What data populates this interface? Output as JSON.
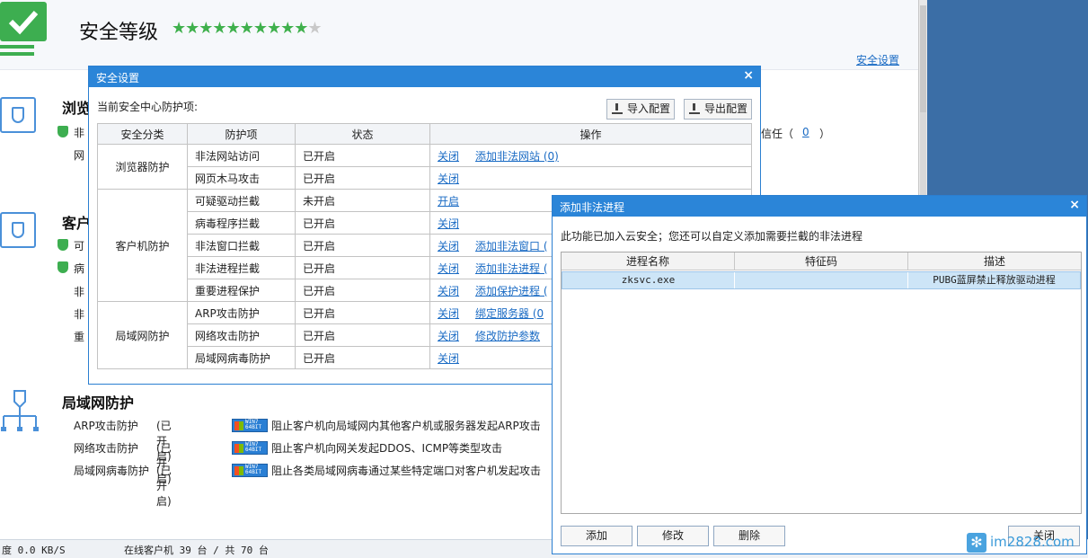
{
  "header": {
    "title": "安全等级",
    "stars_on": "★★★★★★★★★★",
    "stars_off": "★",
    "settings_link": "安全设置"
  },
  "sections": {
    "browser": {
      "title": "浏览"
    },
    "browser_rows": [
      "非",
      "网"
    ],
    "browser_right_text": "信任（",
    "browser_right_count": "0",
    "browser_right_close": "）",
    "client": {
      "title": "客户"
    },
    "client_rows": [
      "可",
      "病",
      "非",
      "非",
      "重"
    ],
    "lan": {
      "title": "局域网防护",
      "rows": [
        {
          "name": "ARP攻击防护",
          "status": "(已开启)",
          "badge": "WIN7 64BIT",
          "desc": "阻止客户机向局域网内其他客户机或服务器发起ARP攻击"
        },
        {
          "name": "网络攻击防护",
          "status": "(已开启)",
          "badge": "WIN7 64BIT",
          "desc": "阻止客户机向网关发起DDOS、ICMP等类型攻击"
        },
        {
          "name": "局域网病毒防护",
          "status": "(已开启)",
          "badge": "WIN7 64BIT",
          "desc": "阻止各类局域网病毒通过某些特定端口对客户机发起攻击"
        }
      ]
    }
  },
  "statusbar": {
    "speed": "度 0.0 KB/S",
    "online": "在线客户机 39 台 / 共 70 台"
  },
  "security_dialog": {
    "title": "安全设置",
    "close": "×",
    "subtitle": "当前安全中心防护项:",
    "import_btn": "导入配置",
    "export_btn": "导出配置",
    "columns": [
      "安全分类",
      "防护项",
      "状态",
      "操作"
    ],
    "groups": [
      {
        "category": "浏览器防护",
        "rows": [
          {
            "item": "非法网站访问",
            "status": "已开启",
            "action": "关闭",
            "extra": "添加非法网站 (0)"
          },
          {
            "item": "网页木马攻击",
            "status": "已开启",
            "action": "关闭",
            "extra": ""
          }
        ]
      },
      {
        "category": "客户机防护",
        "rows": [
          {
            "item": "可疑驱动拦截",
            "status": "未开启",
            "action": "开启",
            "extra": ""
          },
          {
            "item": "病毒程序拦截",
            "status": "已开启",
            "action": "关闭",
            "extra": ""
          },
          {
            "item": "非法窗口拦截",
            "status": "已开启",
            "action": "关闭",
            "extra": "添加非法窗口 ("
          },
          {
            "item": "非法进程拦截",
            "status": "已开启",
            "action": "关闭",
            "extra": "添加非法进程 ("
          },
          {
            "item": "重要进程保护",
            "status": "已开启",
            "action": "关闭",
            "extra": "添加保护进程 ("
          }
        ]
      },
      {
        "category": "局域网防护",
        "rows": [
          {
            "item": "ARP攻击防护",
            "status": "已开启",
            "action": "关闭",
            "extra": "绑定服务器 (0"
          },
          {
            "item": "网络攻击防护",
            "status": "已开启",
            "action": "关闭",
            "extra": "修改防护参数"
          },
          {
            "item": "局域网病毒防护",
            "status": "已开启",
            "action": "关闭",
            "extra": ""
          }
        ]
      }
    ]
  },
  "process_dialog": {
    "title": "添加非法进程",
    "close": "×",
    "description": "此功能已加入云安全；您还可以自定义添加需要拦截的非法进程",
    "columns": [
      "进程名称",
      "特征码",
      "描述"
    ],
    "rows": [
      {
        "name": "zksvc.exe",
        "code": "",
        "desc": "PUBG蓝屏禁止释放驱动进程"
      }
    ],
    "buttons": {
      "add": "添加",
      "edit": "修改",
      "delete": "删除",
      "close": "关闭"
    }
  },
  "watermark": {
    "text": "im2828.com",
    "icon": "snowflake-icon"
  }
}
